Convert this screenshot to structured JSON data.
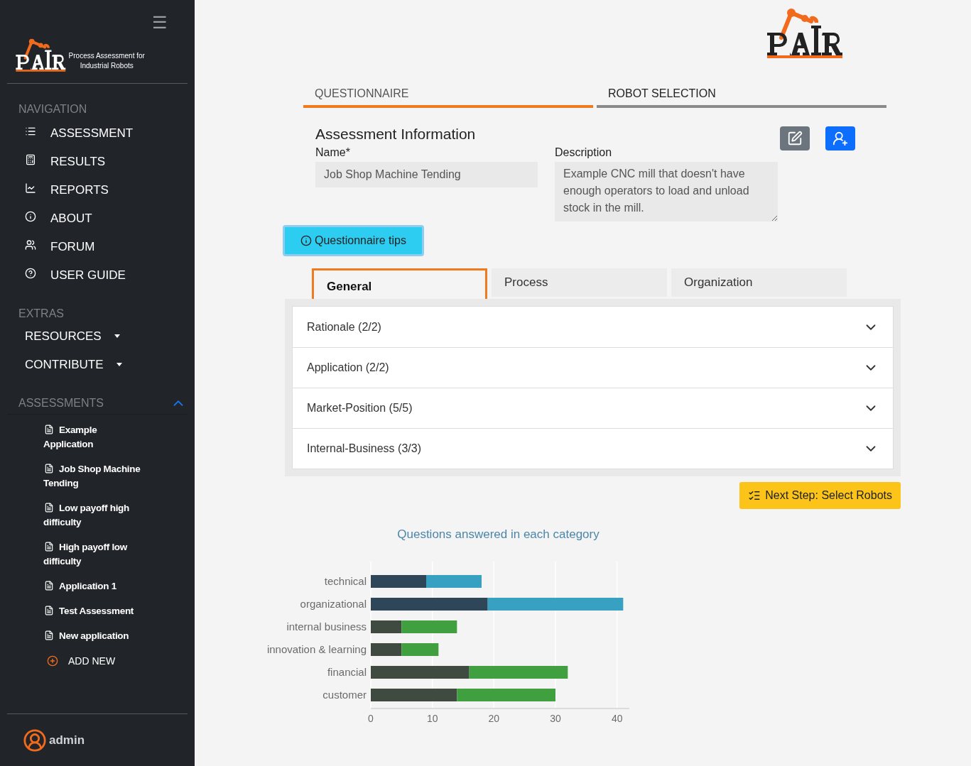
{
  "sidebar": {
    "menu_icon": "☰",
    "logo": {
      "tagline_line1": "Process Assessment for",
      "tagline_line2": "Industrial Robots"
    },
    "navigation": {
      "heading": "NAVIGATION",
      "items": [
        {
          "label": "ASSESSMENT"
        },
        {
          "label": "RESULTS"
        },
        {
          "label": "REPORTS"
        },
        {
          "label": "ABOUT"
        },
        {
          "label": "FORUM"
        },
        {
          "label": "USER GUIDE"
        }
      ]
    },
    "extras": {
      "heading": "EXTRAS",
      "items": [
        {
          "label": "RESOURCES",
          "expanded": false
        },
        {
          "label": "CONTRIBUTE",
          "expanded": false
        }
      ]
    },
    "assessments": {
      "heading": "ASSESSMENTS",
      "expanded": true,
      "items": [
        "Example Application",
        "Job Shop Machine Tending",
        "Low payoff high difficulty",
        "High payoff low difficulty",
        "Application 1",
        "Test Assessment",
        "New application"
      ],
      "add_new": "ADD NEW"
    },
    "user": {
      "name": "admin"
    }
  },
  "main": {
    "top_tabs": [
      {
        "label": "QUESTIONNAIRE",
        "selected": true
      },
      {
        "label": "ROBOT SELECTION",
        "selected": false
      }
    ],
    "info": {
      "title": "Assessment Information",
      "name_label": "Name*",
      "name_value": "Job Shop Machine Tending",
      "description_label": "Description",
      "description_value": "Example CNC mill that doesn't have enough operators to load and unload stock in the mill."
    },
    "tips_button": "Questionnaire tips",
    "category_tabs": [
      {
        "label": "General",
        "selected": true
      },
      {
        "label": "Process",
        "selected": false
      },
      {
        "label": "Organization",
        "selected": false
      }
    ],
    "sections": [
      {
        "label": "Rationale (2/2)",
        "expanded": false
      },
      {
        "label": "Application (2/2)",
        "expanded": false
      },
      {
        "label": "Market-Position (5/5)",
        "expanded": false
      },
      {
        "label": "Internal-Business (3/3)",
        "expanded": false
      }
    ],
    "next_button": "Next Step: Select Robots",
    "chart_data": {
      "type": "bar",
      "orientation": "horizontal",
      "stacked": true,
      "title": "Questions answered in each category",
      "categories": [
        "technical",
        "organizational",
        "internal business",
        "innovation & learning",
        "financial",
        "customer"
      ],
      "series": [
        {
          "color": "#2f4558",
          "values": [
            9,
            19,
            null,
            null,
            null,
            null
          ]
        },
        {
          "color": "#38a0c0",
          "values": [
            9,
            22,
            null,
            null,
            null,
            null
          ]
        },
        {
          "color": "#3f4a40",
          "values": [
            null,
            null,
            5,
            5,
            16,
            14
          ]
        },
        {
          "color": "#40a040",
          "values": [
            null,
            null,
            9,
            6,
            16,
            16
          ]
        }
      ],
      "xlim": [
        0,
        42
      ],
      "xticks": [
        0,
        10,
        20,
        30,
        40
      ],
      "grid": true
    }
  }
}
